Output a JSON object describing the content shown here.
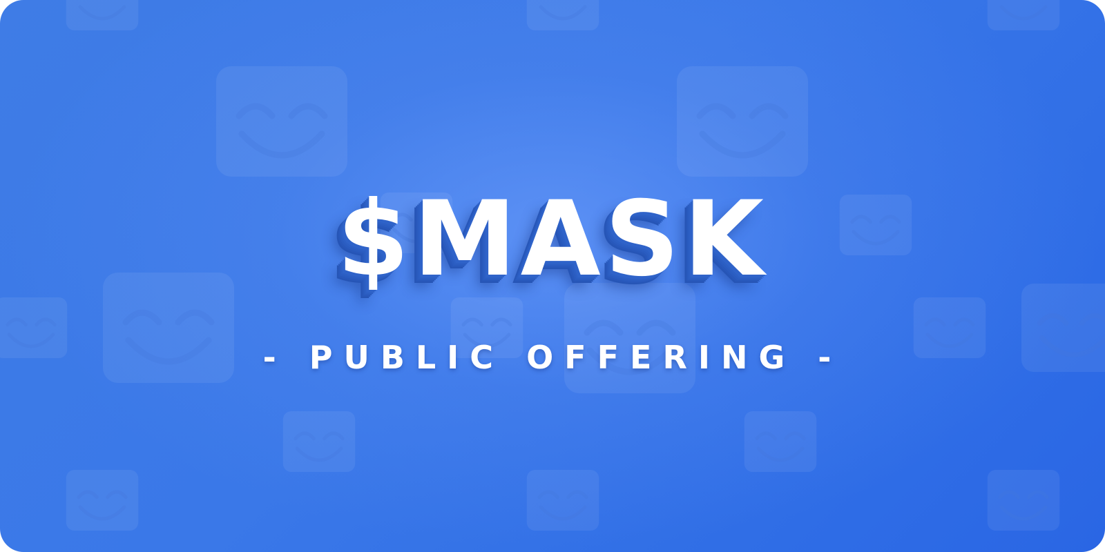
{
  "banner": {
    "title": "$MASK",
    "subtitle": "- PUBLIC OFFERING -",
    "background_color": "#3a78e8",
    "text_color": "#ffffff",
    "pattern_icon": "smiling-mask-icon"
  }
}
